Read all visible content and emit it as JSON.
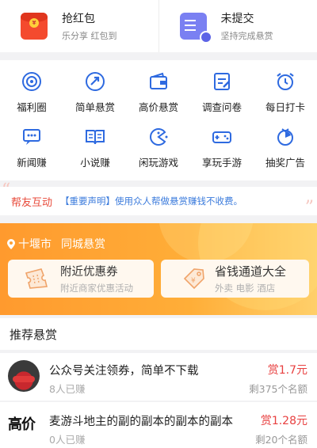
{
  "top_cards": [
    {
      "title": "抢红包",
      "subtitle": "乐分享 红包到",
      "icon": "red-envelope-icon"
    },
    {
      "title": "未提交",
      "subtitle": "坚持完成悬赏",
      "icon": "pending-document-icon"
    }
  ],
  "categories": [
    {
      "label": "福利圈",
      "icon": "welfare-circle-icon"
    },
    {
      "label": "简单悬赏",
      "icon": "simple-reward-icon"
    },
    {
      "label": "高价悬赏",
      "icon": "high-price-wallet-icon"
    },
    {
      "label": "调查问卷",
      "icon": "survey-icon"
    },
    {
      "label": "每日打卡",
      "icon": "alarm-clock-icon"
    },
    {
      "label": "新闻赚",
      "icon": "news-chat-icon"
    },
    {
      "label": "小说赚",
      "icon": "novel-book-icon"
    },
    {
      "label": "闲玩游戏",
      "icon": "pacman-game-icon"
    },
    {
      "label": "享玩手游",
      "icon": "gamepad-icon"
    },
    {
      "label": "抽奖广告",
      "icon": "lottery-icon"
    }
  ],
  "notice": {
    "title": "帮友互动",
    "message": "【重要声明】使用众人帮做悬赏赚钱不收费。"
  },
  "local": {
    "city": "十堰市",
    "label": "同城悬赏",
    "boxes": [
      {
        "title": "附近优惠券",
        "subtitle": "附近商家优惠活动",
        "icon": "coupon-icon"
      },
      {
        "title": "省钱通道大全",
        "subtitle": "外卖 电影 酒店",
        "icon": "price-tag-icon"
      }
    ]
  },
  "recommend": {
    "heading": "推荐悬赏",
    "tasks": [
      {
        "title": "公众号关注领券，简单不下载",
        "count": "8人已赚",
        "price": "赏1.7元",
        "remaining": "剩375个名额",
        "thumb_text": ""
      },
      {
        "title": "麦游斗地主的副的副本的副本的副本",
        "count": "0人已赚",
        "price": "赏1.28元",
        "remaining": "剩20个名额",
        "thumb_text": "高价"
      }
    ]
  },
  "colors": {
    "accent_blue": "#2e6ae0",
    "price_red": "#e84040",
    "notice_red": "#e84a3a",
    "city_orange": "#ff9a2e"
  }
}
